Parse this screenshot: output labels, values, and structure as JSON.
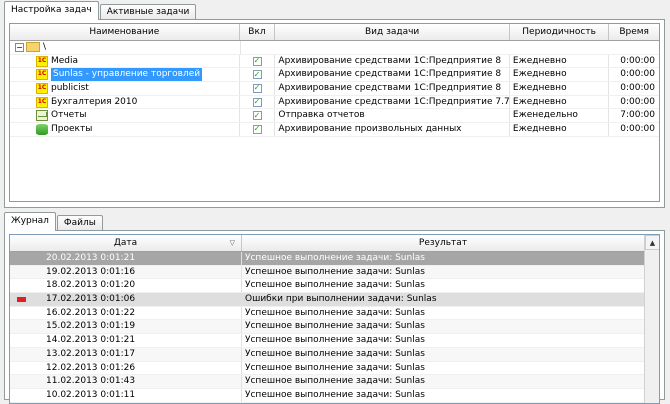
{
  "top_tabs": [
    "Настройка задач",
    "Активные задачи"
  ],
  "tasks": {
    "columns": [
      "Наименование",
      "Вкл",
      "Вид задачи",
      "Периодичность",
      "Время"
    ],
    "root_label": "\\",
    "check_mark": "✓",
    "rows": [
      {
        "name": "Media",
        "icon": "1c-icon",
        "enabled": true,
        "kind": "Архивирование средствами 1С:Предприятие 8",
        "period": "Ежедневно",
        "time": "0:00:00"
      },
      {
        "name": "Sunlas - управление торговлей",
        "icon": "1c-icon",
        "enabled": true,
        "kind": "Архивирование средствами 1С:Предприятие 8",
        "period": "Ежедневно",
        "time": "0:00:00",
        "selected": true
      },
      {
        "name": "publicist",
        "icon": "1c-icon",
        "enabled": true,
        "kind": "Архивирование средствами 1С:Предприятие 8",
        "period": "Ежедневно",
        "time": "0:00:00"
      },
      {
        "name": "Бухгалтерия 2010",
        "icon": "1c-icon",
        "enabled": true,
        "kind": "Архивирование средствами 1С:Предприятие 7.7",
        "period": "Ежедневно",
        "time": "0:00:00"
      },
      {
        "name": "Отчеты",
        "icon": "mail-icon",
        "enabled": true,
        "kind": "Отправка отчетов",
        "period": "Еженедельно",
        "time": "7:00:00"
      },
      {
        "name": "Проекты",
        "icon": "database-icon",
        "enabled": true,
        "kind": "Архивирование произвольных данных",
        "period": "Ежедневно",
        "time": "0:00:00"
      }
    ]
  },
  "bottom_tabs": [
    "Журнал",
    "Файлы"
  ],
  "log": {
    "columns": [
      "Дата",
      "Результат"
    ],
    "rows": [
      {
        "date": "20.02.2013 0:01:21",
        "result": "Успешное выполнение задачи: Sunlas",
        "state": "selected"
      },
      {
        "date": "19.02.2013 0:01:16",
        "result": "Успешное выполнение задачи: Sunlas",
        "state": "ok"
      },
      {
        "date": "18.02.2013 0:01:20",
        "result": "Успешное выполнение задачи: Sunlas",
        "state": "ok"
      },
      {
        "date": "17.02.2013 0:01:06",
        "result": "Ошибки при выполнении задачи: Sunlas",
        "state": "error"
      },
      {
        "date": "16.02.2013 0:01:22",
        "result": "Успешное выполнение задачи: Sunlas",
        "state": "ok"
      },
      {
        "date": "15.02.2013 0:01:19",
        "result": "Успешное выполнение задачи: Sunlas",
        "state": "ok"
      },
      {
        "date": "14.02.2013 0:01:21",
        "result": "Успешное выполнение задачи: Sunlas",
        "state": "ok"
      },
      {
        "date": "13.02.2013 0:01:17",
        "result": "Успешное выполнение задачи: Sunlas",
        "state": "ok"
      },
      {
        "date": "12.02.2013 0:01:26",
        "result": "Успешное выполнение задачи: Sunlas",
        "state": "ok"
      },
      {
        "date": "11.02.2013 0:01:43",
        "result": "Успешное выполнение задачи: Sunlas",
        "state": "ok"
      },
      {
        "date": "10.02.2013 0:01:11",
        "result": "Успешное выполнение задачи: Sunlas",
        "state": "ok"
      }
    ]
  },
  "colors": {
    "selection": "#3399ff",
    "log_selected": "#a6a6a6",
    "error": "#e02020"
  }
}
